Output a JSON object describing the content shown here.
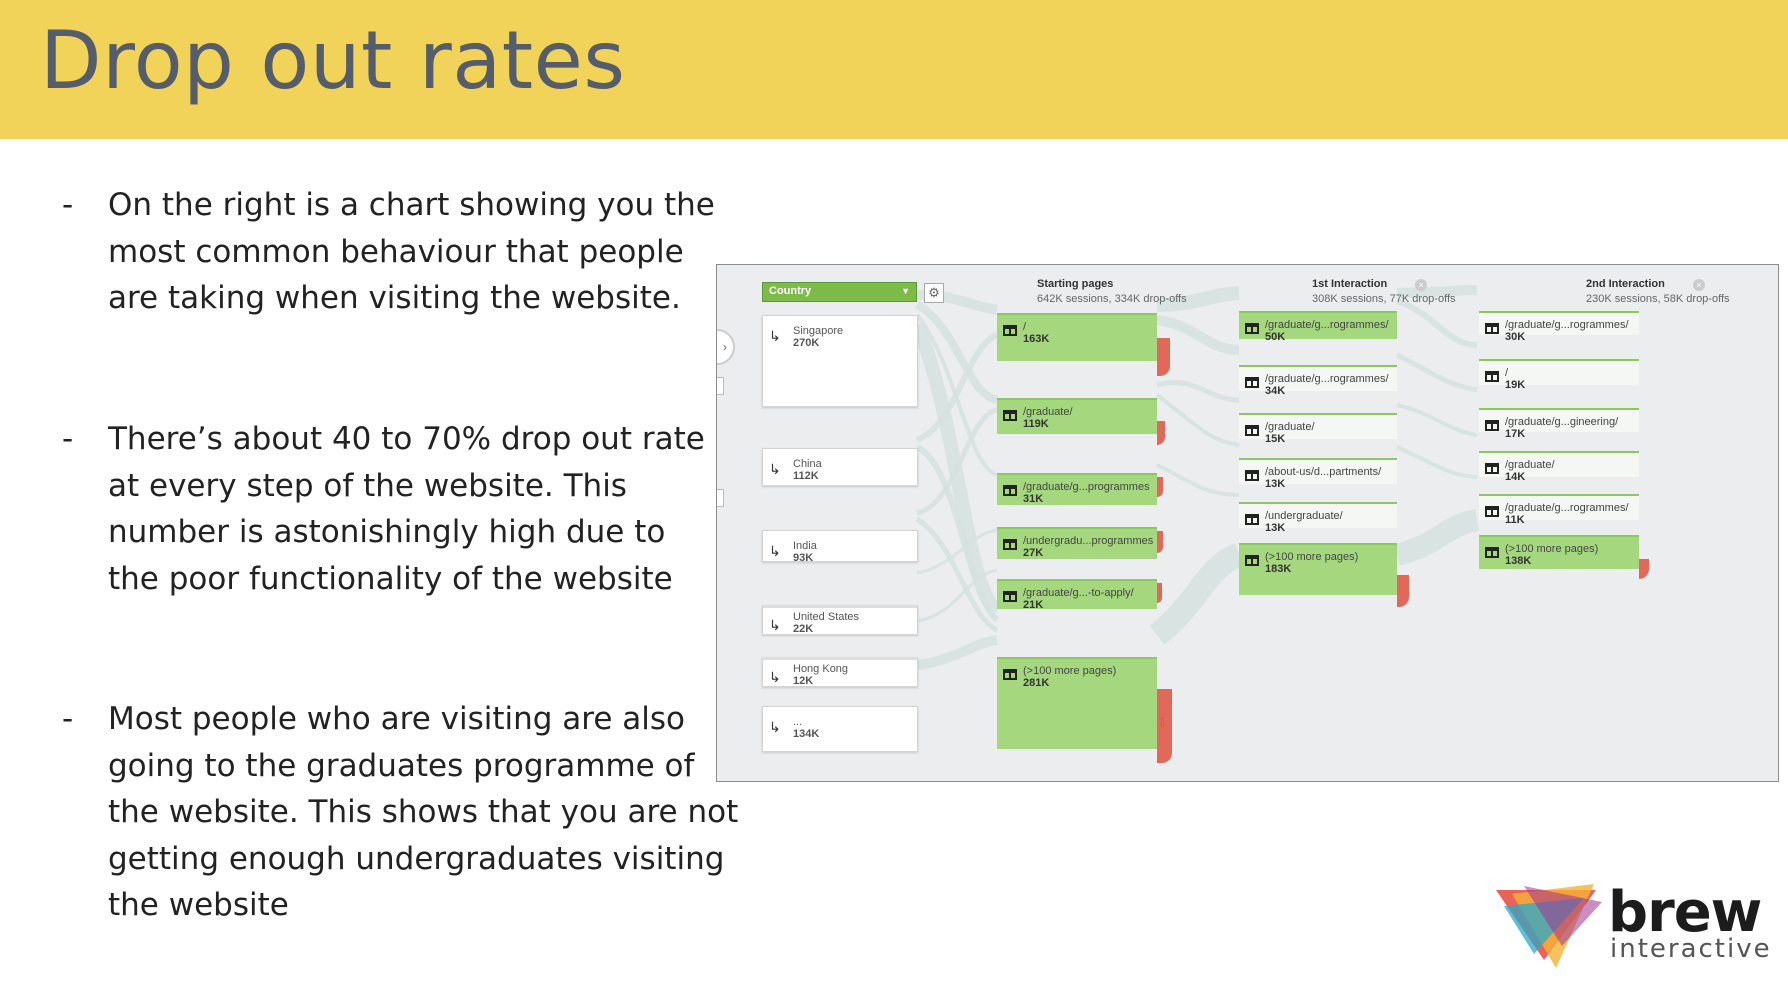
{
  "slide": {
    "title": "Drop out rates",
    "bullets": [
      "On the right is a chart showing you the most common behaviour that people are taking when visiting the website.",
      "There’s about 40 to 70% drop out rate at every step of the website. This number is astonishingly high due to the poor functionality of the website",
      "Most people who are visiting are also going to the graduates programme of the website. This shows that you are not getting enough undergraduates visiting the website"
    ],
    "dash": "-"
  },
  "flow": {
    "dimension_select": "Country",
    "columns": [
      {
        "title": "Starting pages",
        "subtitle": "642K sessions, 334K drop-offs"
      },
      {
        "title": "1st Interaction",
        "subtitle": "308K sessions, 77K drop-offs"
      },
      {
        "title": "2nd Interaction",
        "subtitle": "230K sessions, 58K drop-offs"
      }
    ],
    "countries": [
      {
        "label": "Singapore",
        "value": "270K"
      },
      {
        "label": "China",
        "value": "112K"
      },
      {
        "label": "India",
        "value": "93K"
      },
      {
        "label": "United States",
        "value": "22K"
      },
      {
        "label": "Hong Kong",
        "value": "12K"
      },
      {
        "label": "...",
        "value": "134K"
      }
    ],
    "starting_pages": [
      {
        "label": "/",
        "value": "163K"
      },
      {
        "label": "/graduate/",
        "value": "119K"
      },
      {
        "label": "/graduate/g...programmes",
        "value": "31K"
      },
      {
        "label": "/undergradu...programmes",
        "value": "27K"
      },
      {
        "label": "/graduate/g...-to-apply/",
        "value": "21K"
      },
      {
        "label": "(>100 more pages)",
        "value": "281K"
      }
    ],
    "first_interaction": [
      {
        "label": "/graduate/g...rogrammes/",
        "value": "50K"
      },
      {
        "label": "/graduate/g...rogrammes/",
        "value": "34K"
      },
      {
        "label": "/graduate/",
        "value": "15K"
      },
      {
        "label": "/about-us/d...partments/",
        "value": "13K"
      },
      {
        "label": "/undergraduate/",
        "value": "13K"
      },
      {
        "label": "(>100 more pages)",
        "value": "183K"
      }
    ],
    "second_interaction": [
      {
        "label": "/graduate/g...rogrammes/",
        "value": "30K"
      },
      {
        "label": "/",
        "value": "19K"
      },
      {
        "label": "/graduate/g...gineering/",
        "value": "17K"
      },
      {
        "label": "/graduate/",
        "value": "14K"
      },
      {
        "label": "/graduate/g...rogrammes/",
        "value": "11K"
      },
      {
        "label": "(>100 more pages)",
        "value": "138K"
      }
    ]
  },
  "logo": {
    "brand": "brew",
    "tagline": "interactive"
  }
}
